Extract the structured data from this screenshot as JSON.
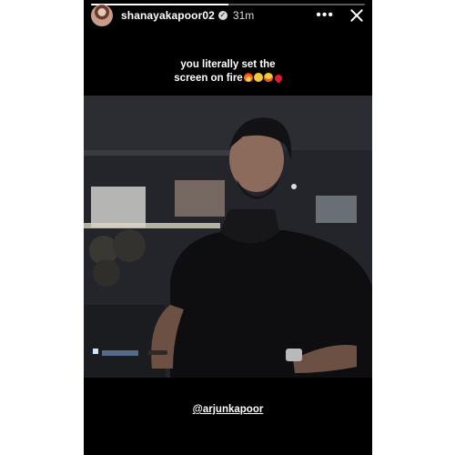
{
  "story": {
    "username": "shanayakapoor02",
    "time_ago": "31m",
    "progress_fraction": 0.5,
    "caption_line1": "you literally set the",
    "caption_line2": "screen on fire",
    "caption_emojis": [
      "fire",
      "smirking-face",
      "heart-eyes-face",
      "red-heart"
    ],
    "mention": "@arjunkapoor",
    "more_icon": "more-dots-icon",
    "close_icon": "close-icon",
    "verified_icon": "verified-badge-icon"
  },
  "colors": {
    "story_background": "#000000",
    "page_background": "#ffffff",
    "text": "#ffffff",
    "heart": "#e01e2e"
  }
}
